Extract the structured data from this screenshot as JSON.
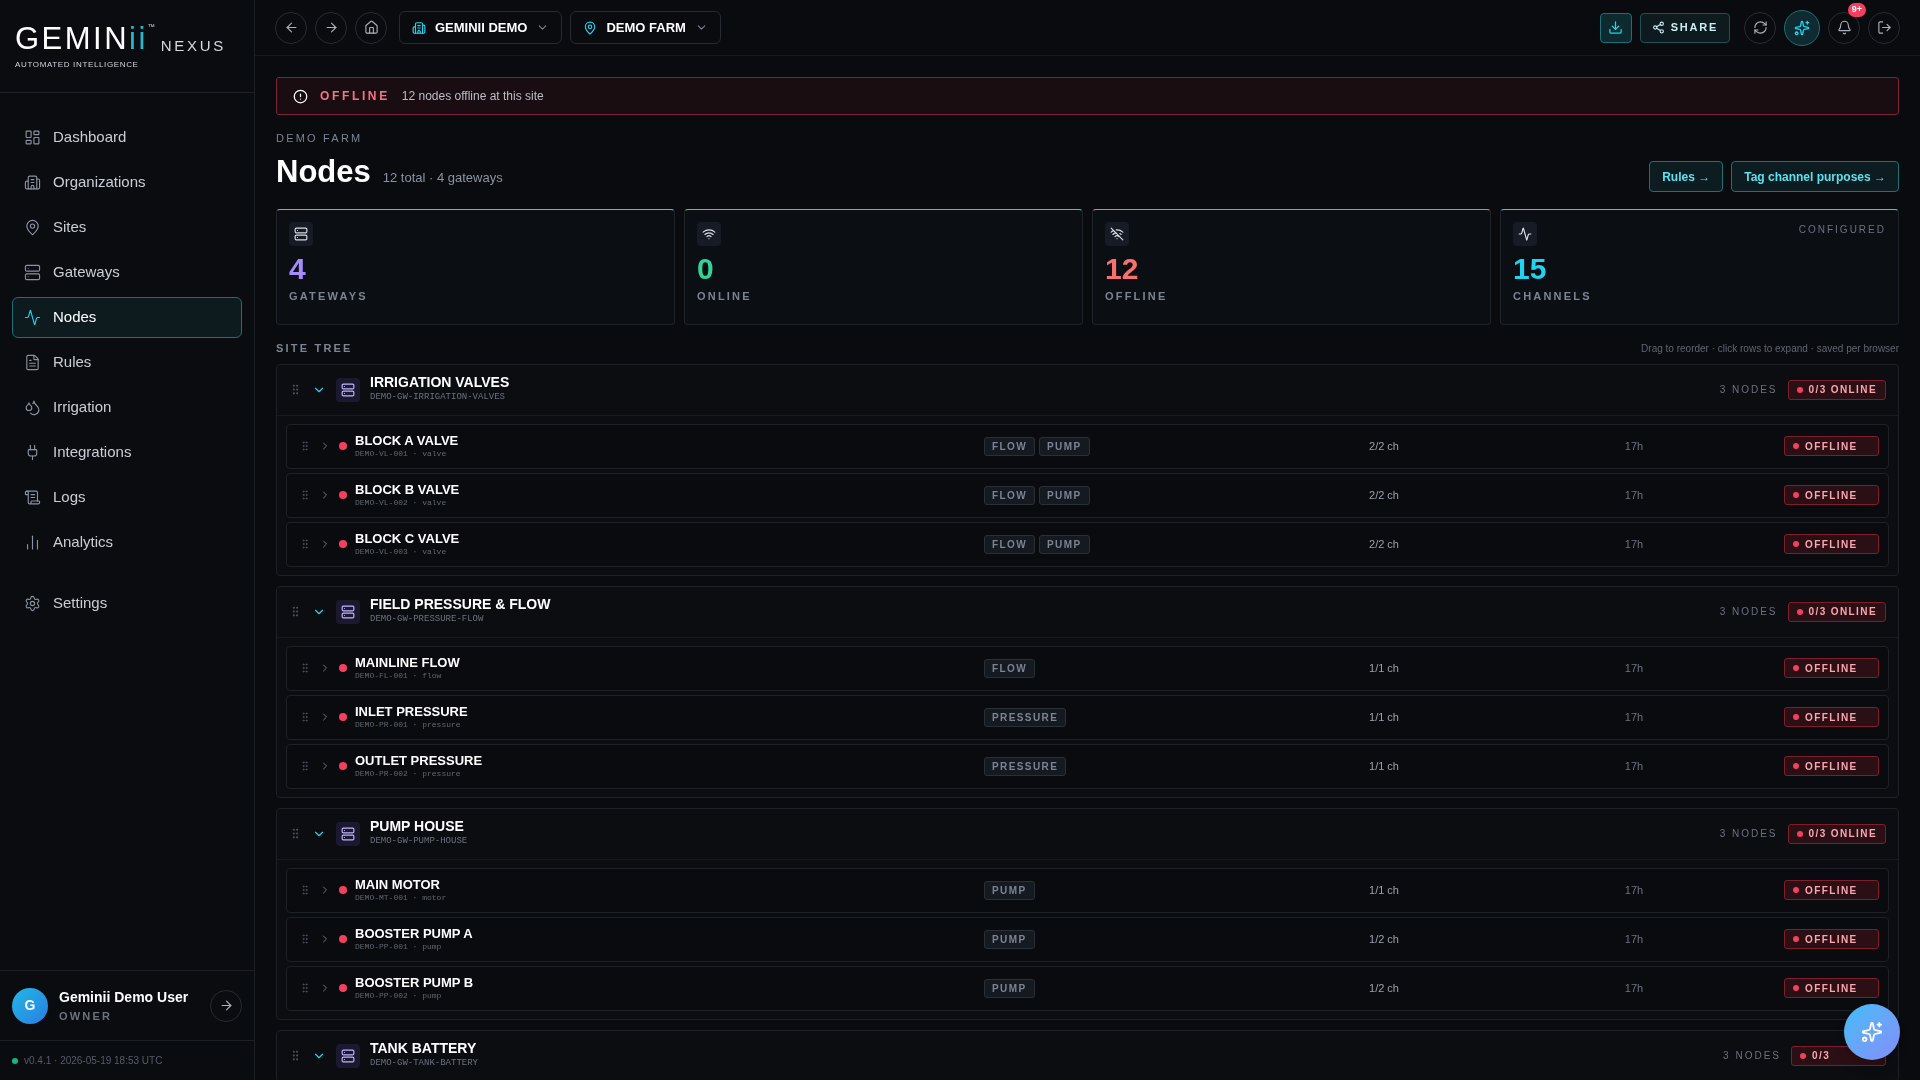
{
  "logo": {
    "word": "GEMIN",
    "accent": "ii",
    "trademark": "™",
    "suffix": "NEXUS",
    "tagline": "AUTOMATED INTELLIGENCE"
  },
  "sidebar": {
    "items": [
      {
        "label": "Dashboard",
        "selected": false
      },
      {
        "label": "Organizations",
        "selected": false
      },
      {
        "label": "Sites",
        "selected": false
      },
      {
        "label": "Gateways",
        "selected": false
      },
      {
        "label": "Nodes",
        "selected": true
      },
      {
        "label": "Rules",
        "selected": false
      },
      {
        "label": "Irrigation",
        "selected": false
      },
      {
        "label": "Integrations",
        "selected": false
      },
      {
        "label": "Logs",
        "selected": false
      },
      {
        "label": "Analytics",
        "selected": false
      }
    ],
    "settings": {
      "label": "Settings",
      "selected": false
    },
    "user": {
      "initial": "G",
      "name": "Geminii Demo User",
      "role": "OWNER"
    },
    "version": "v0.4.1 · 2026-05-19 18:53 UTC"
  },
  "topbar": {
    "org": "GEMINII DEMO",
    "site": "DEMO FARM",
    "share": "SHARE",
    "notifications": "9+"
  },
  "banner": {
    "status": "OFFLINE",
    "message": "12 nodes offline at this site"
  },
  "header": {
    "eyebrow": "DEMO FARM",
    "title": "Nodes",
    "summary": "12 total · 4 gateways",
    "buttons": [
      "Rules →",
      "Tag channel purposes →"
    ]
  },
  "stats": [
    {
      "value": "4",
      "label": "GATEWAYS",
      "color": "#a78bfa"
    },
    {
      "value": "0",
      "label": "ONLINE",
      "color": "#34d399"
    },
    {
      "value": "12",
      "label": "OFFLINE",
      "color": "#f87171"
    },
    {
      "value": "15",
      "label": "CHANNELS",
      "color": "#22d3ee",
      "note": "CONFIGURED"
    }
  ],
  "site_tree": {
    "title": "SITE TREE",
    "hint": "Drag to reorder · click rows to expand · saved per browser",
    "groups": [
      {
        "name": "IRRIGATION VALVES",
        "id": "DEMO-GW-IRRIGATION-VALVES",
        "count": "3 NODES",
        "badge": "0/3 ONLINE",
        "expanded": true,
        "nodes": [
          {
            "name": "BLOCK A VALVE",
            "id": "DEMO-VL-001 · valve",
            "tags": [
              "FLOW",
              "PUMP"
            ],
            "channels": "2/2 ch",
            "age": "17h",
            "status": "OFFLINE",
            "online": false
          },
          {
            "name": "BLOCK B VALVE",
            "id": "DEMO-VL-002 · valve",
            "tags": [
              "FLOW",
              "PUMP"
            ],
            "channels": "2/2 ch",
            "age": "17h",
            "status": "OFFLINE",
            "online": false
          },
          {
            "name": "BLOCK C VALVE",
            "id": "DEMO-VL-003 · valve",
            "tags": [
              "FLOW",
              "PUMP"
            ],
            "channels": "2/2 ch",
            "age": "17h",
            "status": "OFFLINE",
            "online": false
          }
        ]
      },
      {
        "name": "FIELD PRESSURE & FLOW",
        "id": "DEMO-GW-PRESSURE-FLOW",
        "count": "3 NODES",
        "badge": "0/3 ONLINE",
        "expanded": true,
        "nodes": [
          {
            "name": "MAINLINE FLOW",
            "id": "DEMO-FL-001 · flow",
            "tags": [
              "FLOW"
            ],
            "channels": "1/1 ch",
            "age": "17h",
            "status": "OFFLINE",
            "online": false
          },
          {
            "name": "INLET PRESSURE",
            "id": "DEMO-PR-001 · pressure",
            "tags": [
              "PRESSURE"
            ],
            "channels": "1/1 ch",
            "age": "17h",
            "status": "OFFLINE",
            "online": false
          },
          {
            "name": "OUTLET PRESSURE",
            "id": "DEMO-PR-002 · pressure",
            "tags": [
              "PRESSURE"
            ],
            "channels": "1/1 ch",
            "age": "17h",
            "status": "OFFLINE",
            "online": false
          }
        ]
      },
      {
        "name": "PUMP HOUSE",
        "id": "DEMO-GW-PUMP-HOUSE",
        "count": "3 NODES",
        "badge": "0/3 ONLINE",
        "expanded": true,
        "nodes": [
          {
            "name": "MAIN MOTOR",
            "id": "DEMO-MT-001 · motor",
            "tags": [
              "PUMP"
            ],
            "channels": "1/1 ch",
            "age": "17h",
            "status": "OFFLINE",
            "online": false
          },
          {
            "name": "BOOSTER PUMP A",
            "id": "DEMO-PP-001 · pump",
            "tags": [
              "PUMP"
            ],
            "channels": "1/2 ch",
            "age": "17h",
            "status": "OFFLINE",
            "online": false
          },
          {
            "name": "BOOSTER PUMP B",
            "id": "DEMO-PP-002 · pump",
            "tags": [
              "PUMP"
            ],
            "channels": "1/2 ch",
            "age": "17h",
            "status": "OFFLINE",
            "online": false
          }
        ]
      },
      {
        "name": "TANK BATTERY",
        "id": "DEMO-GW-TANK-BATTERY",
        "count": "3 NODES",
        "badge": "0/3",
        "expanded": true
      }
    ]
  }
}
